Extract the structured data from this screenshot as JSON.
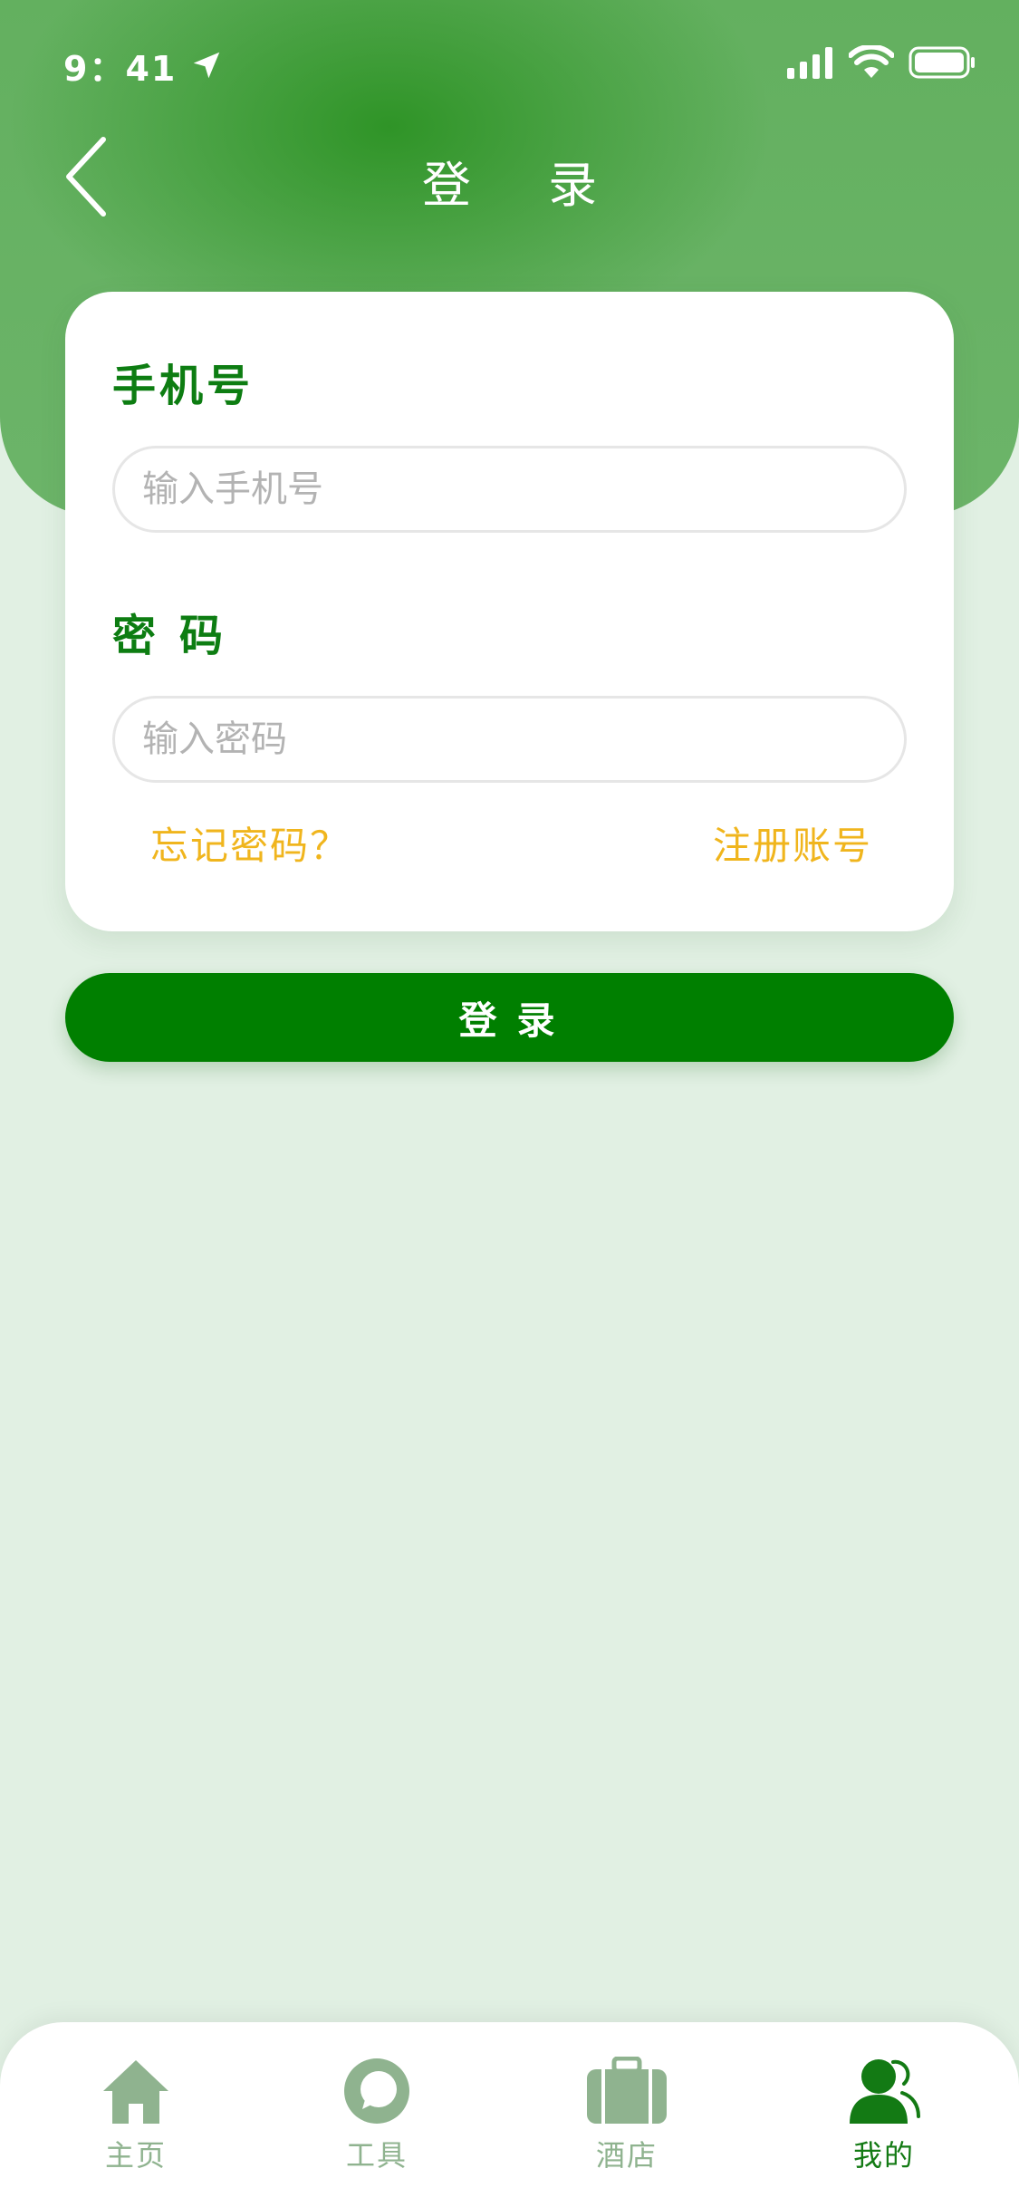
{
  "status_bar": {
    "time": "9：41"
  },
  "nav": {
    "title": "登 录"
  },
  "form": {
    "phone_label": "手机号",
    "phone_placeholder": "输入手机号",
    "password_label": "密码",
    "password_placeholder": "输入密码",
    "forgot_label": "忘记密码？",
    "register_label": "注册账号"
  },
  "login_button": {
    "label": "登录"
  },
  "tabbar": {
    "items": [
      {
        "label": "主页",
        "icon": "home-icon"
      },
      {
        "label": "工具",
        "icon": "chat-bubble-icon"
      },
      {
        "label": "酒店",
        "icon": "suitcase-icon"
      },
      {
        "label": "我的",
        "icon": "user-icon"
      }
    ],
    "active_index": 3
  },
  "colors": {
    "primary": "#007f00",
    "label_green": "#0d7d12",
    "link_yellow": "#f0b51d",
    "tab_inactive": "#8fb38f",
    "background": "#e1f0e3"
  }
}
